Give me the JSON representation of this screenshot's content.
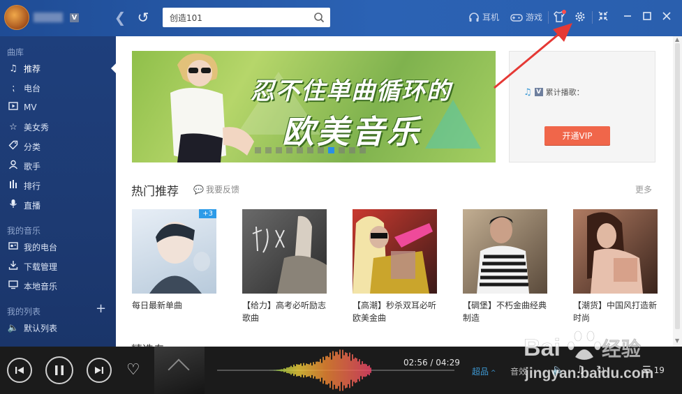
{
  "topbar": {
    "vip_badge": "V",
    "search": {
      "value": "创造101",
      "placeholder": ""
    },
    "headphone_label": "耳机",
    "game_label": "游戏"
  },
  "sidebar": {
    "library_title": "曲库",
    "library_items": [
      {
        "label": "推荐",
        "icon": "music-note-icon",
        "active": true
      },
      {
        "label": "电台",
        "icon": "radio-icon"
      },
      {
        "label": "MV",
        "icon": "mv-icon"
      },
      {
        "label": "美女秀",
        "icon": "star-icon"
      },
      {
        "label": "分类",
        "icon": "tag-icon"
      },
      {
        "label": "歌手",
        "icon": "person-icon"
      },
      {
        "label": "排行",
        "icon": "bars-icon"
      },
      {
        "label": "直播",
        "icon": "mic-icon"
      }
    ],
    "my_music_title": "我的音乐",
    "my_music_items": [
      {
        "label": "我的电台",
        "icon": "my-radio-icon"
      },
      {
        "label": "下载管理",
        "icon": "download-icon"
      },
      {
        "label": "本地音乐",
        "icon": "monitor-icon"
      }
    ],
    "my_list_title": "我的列表",
    "list_items": [
      {
        "label": "默认列表",
        "icon": "speaker-icon"
      }
    ]
  },
  "banner": {
    "line1": "忍不住单曲循环的",
    "line2": "欧美音乐",
    "dot_count": 11,
    "active_dot": 7
  },
  "vip_panel": {
    "badge": "V",
    "label": "累计播歌：",
    "button": "开通VIP"
  },
  "hot": {
    "title": "热门推荐",
    "feedback": "我要反馈",
    "more": "更多",
    "cards": [
      {
        "caption": "每日最新单曲",
        "badge": "+3",
        "palette": [
          "#dfe9f3",
          "#7f9bb8"
        ]
      },
      {
        "caption": "【给力】高考必听励志歌曲",
        "palette": [
          "#5e5e5e",
          "#2c2c2c"
        ]
      },
      {
        "caption": "【高潮】秒杀双耳必听欧美金曲",
        "palette": [
          "#d14b3f",
          "#2b1c1a"
        ]
      },
      {
        "caption": "【碉堡】不朽金曲经典制造",
        "palette": [
          "#b9a48a",
          "#3b3128"
        ]
      },
      {
        "caption": "【潮货】中国风打造新时尚",
        "palette": [
          "#c98f72",
          "#4a2d22"
        ]
      }
    ]
  },
  "next_section": "精选专",
  "player": {
    "time": "02:56 / 04:29",
    "quality": "超品",
    "effect": "音效",
    "queue_count": "19",
    "progress": 0.65
  },
  "watermark": {
    "brand_a": "Bai",
    "brand_b": "经验",
    "url": "jingyan.baidu.com"
  },
  "colors": {
    "topbar": "#2b62b4",
    "sidebar": "#1e3f7c",
    "accent": "#3e9ad5",
    "vip_button": "#f0664a",
    "annotation": "#e53935"
  }
}
